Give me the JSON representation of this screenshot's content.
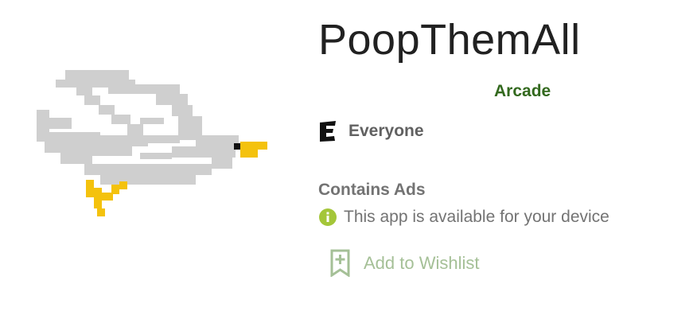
{
  "app": {
    "title": "PoopThemAll",
    "category": "Arcade",
    "content_rating": "Everyone",
    "ads_label": "Contains Ads",
    "availability": "This app is available for your device",
    "wishlist_label": "Add to Wishlist"
  },
  "icons": {
    "app_icon": "pixel-seagull-icon",
    "rating": "esrb-everyone-icon",
    "availability": "info-icon",
    "wishlist": "bookmark-add-icon"
  },
  "colors": {
    "category": "#33691e",
    "info_icon": "#a4c639",
    "wishlist": "#a5c097",
    "gull_body": "#cfcfcf",
    "gull_beak": "#f4c20d"
  }
}
